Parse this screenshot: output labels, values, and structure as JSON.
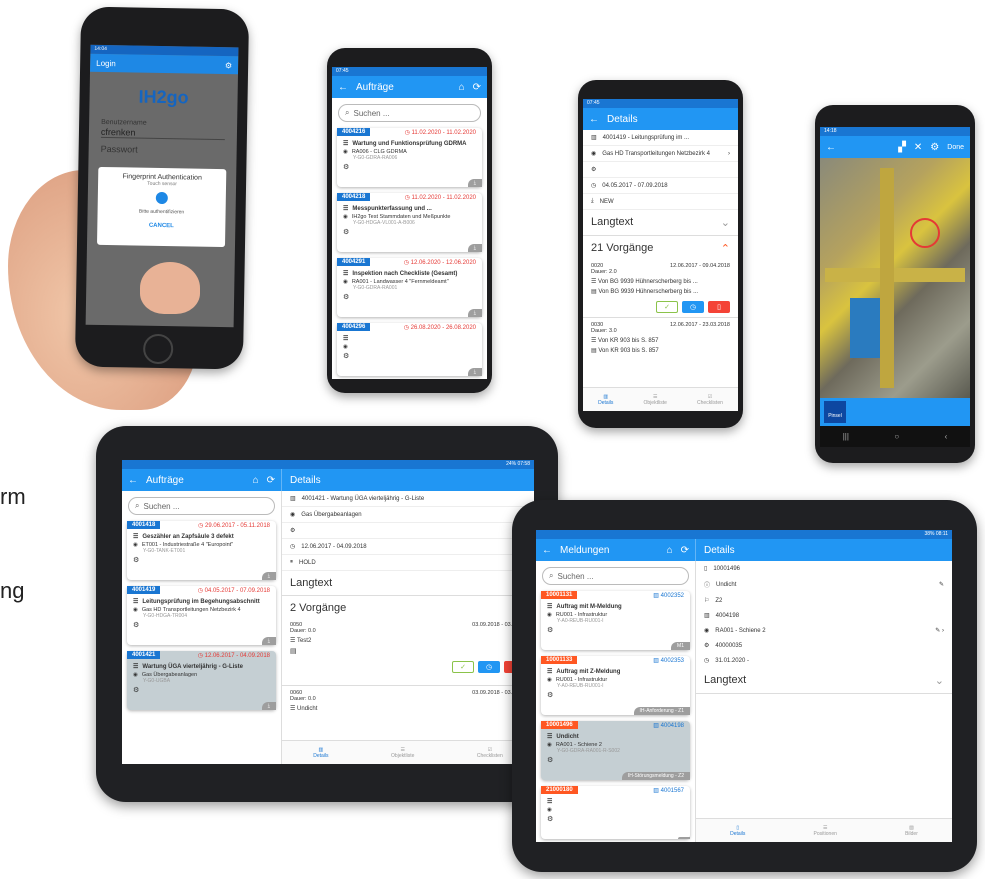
{
  "edge_text": {
    "left1": "rm",
    "left2": "ng"
  },
  "phone1": {
    "status": "14:04",
    "title": "Login",
    "logo": "IH2go",
    "username_label": "Benutzername",
    "username": "cfrenken",
    "password_label": "Passwort",
    "dialog_title": "Fingerprint Authentication",
    "dialog_sub": "Touch sensor",
    "dialog_hint": "Bitte authentifizieren",
    "cancel": "CANCEL"
  },
  "phone2": {
    "status": "07:45",
    "title": "Aufträge",
    "search": "Suchen ...",
    "cards": [
      {
        "id": "4004216",
        "date": "11.02.2020 - 11.02.2020",
        "title": "Wartung und Funktionsprüfung GDRMA",
        "loc": "RA006 - CLG GDRMA",
        "sub": "Y-G0-GDRA-RA006"
      },
      {
        "id": "4004218",
        "date": "11.02.2020 - 11.02.2020",
        "title": "Messpunkterfassung und ...",
        "loc": "IH2go Test Stammdaten und Meßpunkte",
        "sub": "Y-G0-HDGA-VL001-A-B006"
      },
      {
        "id": "4004291",
        "date": "12.06.2020 - 12.06.2020",
        "title": "Inspektion nach Checkliste (Gesamt)",
        "loc": "RA001 - Landwasser 4 \"Fernmeldeamt\"",
        "sub": "Y-G0-GDRA-RA001"
      },
      {
        "id": "4004296",
        "date": "26.08.2020 - 26.08.2020",
        "title": "",
        "loc": "",
        "sub": ""
      }
    ]
  },
  "phone3": {
    "status": "07:45",
    "title": "Details",
    "rows": [
      "4001419 - Leitungsprüfung im ...",
      "Gas HD Transportleitungen Netzbezirk 4",
      "",
      "04.05.2017 - 07.09.2018",
      "NEW"
    ],
    "langtext": "Langtext",
    "vorgaenge": "21 Vorgänge",
    "op1": {
      "no": "0020",
      "dauer": "Dauer: 2.0",
      "date": "12.06.2017 - 09.04.2018",
      "l1": "Von BG 9939 Hühnerscherberg bis ...",
      "l2": "Von BG 9939 Hühnerscherberg bis ..."
    },
    "op2": {
      "no": "0030",
      "dauer": "Dauer: 3.0",
      "date": "12.06.2017 - 23.03.2018",
      "l1": "Von KR 903 bis S. 857",
      "l2": "Von KR 903 bis S. 857"
    },
    "nav": [
      "Details",
      "Objektliste",
      "Checklisten"
    ]
  },
  "phone4": {
    "status": "14:18",
    "done": "Done",
    "tool": "Pinsel"
  },
  "tablet1": {
    "status": "24% 07:58",
    "list_title": "Aufträge",
    "detail_title": "Details",
    "search": "Suchen ...",
    "cards": [
      {
        "id": "4001418",
        "date": "29.06.2017 - 05.11.2018",
        "title": "Geszähler an Zapfsäule 3 defekt",
        "loc": "ET001 - Industriestraße 4 \"Europoint\"",
        "sub": "Y-G0-TANK-ET001",
        "sel": false
      },
      {
        "id": "4001419",
        "date": "04.05.2017 - 07.09.2018",
        "title": "Leitungsprüfung im Begehungsabschnitt",
        "loc": "Gas HD Transportleitungen Netzbezirk 4",
        "sub": "Y-G0-HDGA-TR004",
        "sel": false
      },
      {
        "id": "4001421",
        "date": "12.06.2017 - 04.09.2018",
        "title": "Wartung ÜGA vierteljährig - G-Liste",
        "loc": "Gas Übergabeanlagen",
        "sub": "Y-G0-UGBA",
        "sel": true
      }
    ],
    "rows": [
      "4001421 - Wartung ÜGA vierteljährig - G-Liste",
      "Gas Übergabeanlagen",
      "",
      "12.06.2017 - 04.09.2018",
      "HOLD"
    ],
    "langtext": "Langtext",
    "vorgaenge": "2 Vorgänge",
    "op1": {
      "no": "0050",
      "dauer": "Dauer: 0.0",
      "date": "03.09.2018 - 03.09.20",
      "l1": "Test2"
    },
    "op2": {
      "no": "0060",
      "dauer": "Dauer: 0.0",
      "date": "03.09.2018 - 03.09.20",
      "l1": "Undicht"
    },
    "nav": [
      "Details",
      "Objektliste",
      "Checklisten"
    ]
  },
  "tablet2": {
    "status": "38% 08:11",
    "list_title": "Meldungen",
    "detail_title": "Details",
    "search": "Suchen ...",
    "cards": [
      {
        "id": "10001131",
        "order": "4002352",
        "title": "Auftrag mit M-Meldung",
        "loc": "RU001 - Infrastruktur",
        "sub": "Y-A0-REUB-RU001-I",
        "tag": "M1",
        "sel": false
      },
      {
        "id": "10001133",
        "order": "4002353",
        "title": "Auftrag mit Z-Meldung",
        "loc": "RU001 - Infrastruktur",
        "sub": "Y-A0-REUB-RU001-I",
        "tag": "IH-Anforderung - Z1",
        "sel": false
      },
      {
        "id": "10001496",
        "order": "4004198",
        "title": "Undicht",
        "loc": "RA001 - Schiene 2",
        "sub": "Y-G0-GDRA-RA001-R-S002",
        "tag": "IH-Störungsmeldung - Z2",
        "sel": true
      },
      {
        "id": "21000180",
        "order": "4001567",
        "title": "",
        "loc": "",
        "sub": "",
        "tag": "",
        "sel": false
      }
    ],
    "rows": [
      "10001496",
      "Undicht",
      "Z2",
      "4004198",
      "RA001 - Schiene 2",
      "40000035",
      "31.01.2020 -"
    ],
    "langtext": "Langtext",
    "nav": [
      "Details",
      "Positionen",
      "Bilder"
    ]
  }
}
